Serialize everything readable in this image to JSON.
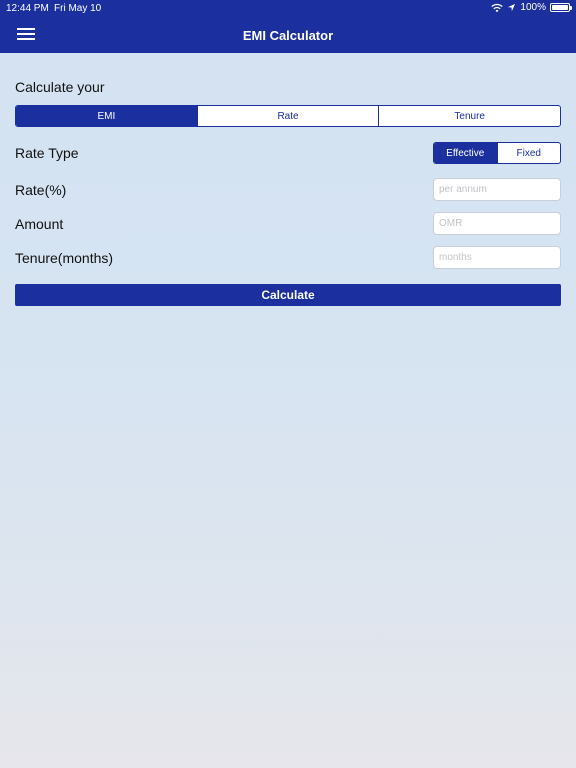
{
  "status_bar": {
    "time": "12:44 PM",
    "date": "Fri May 10",
    "battery": "100%"
  },
  "header": {
    "title": "EMI Calculator",
    "menu_icon": "hamburger-menu-icon",
    "background_color": "#1b2f9e"
  },
  "calculate": {
    "label": "Calculate your",
    "tabs": [
      {
        "label": "EMI",
        "selected": true
      },
      {
        "label": "Rate",
        "selected": false
      },
      {
        "label": "Tenure",
        "selected": false
      }
    ]
  },
  "rate_type": {
    "label": "Rate Type",
    "options": [
      {
        "label": "Effective",
        "selected": true
      },
      {
        "label": "Fixed",
        "selected": false
      }
    ]
  },
  "fields": {
    "rate": {
      "label": "Rate(%)",
      "placeholder": "per annum",
      "value": ""
    },
    "amount": {
      "label": "Amount",
      "placeholder": "OMR",
      "value": ""
    },
    "tenure": {
      "label": "Tenure(months)",
      "placeholder": "months",
      "value": ""
    }
  },
  "actions": {
    "calculate_label": "Calculate"
  }
}
